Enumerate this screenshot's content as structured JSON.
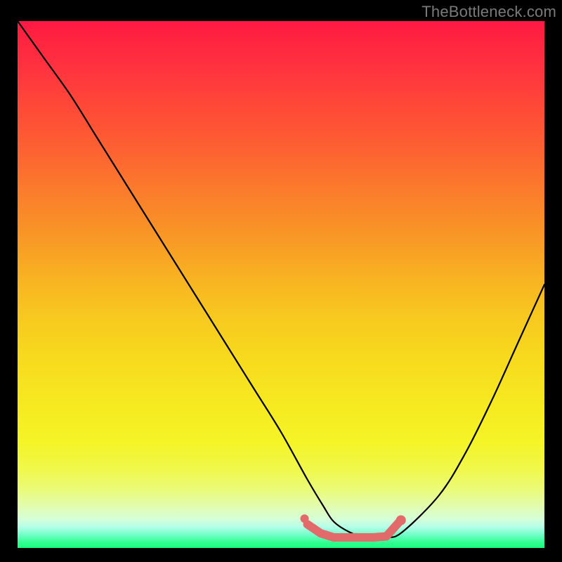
{
  "watermark": "TheBottleneck.com",
  "chart_data": {
    "type": "line",
    "title": "",
    "xlabel": "",
    "ylabel": "",
    "xlim": [
      0,
      100
    ],
    "ylim": [
      0,
      100
    ],
    "grid": false,
    "series": [
      {
        "name": "curve",
        "color": "#000000",
        "x": [
          0,
          5,
          10,
          15,
          20,
          25,
          30,
          35,
          40,
          45,
          50,
          55,
          58,
          60,
          63,
          66,
          70,
          73,
          80,
          85,
          90,
          95,
          100
        ],
        "y": [
          100,
          93,
          86,
          78,
          70,
          62,
          54,
          46,
          38,
          30,
          22,
          13,
          8,
          5,
          3,
          2,
          2,
          3,
          10,
          18,
          28,
          39,
          50
        ]
      },
      {
        "name": "trough-marker",
        "color": "#e26a6a",
        "x": [
          55,
          57.5,
          60,
          62.5,
          65,
          67.5,
          70,
          72.5
        ],
        "y": [
          4.5,
          2.8,
          2.0,
          2.0,
          2.0,
          2.0,
          2.2,
          5.0
        ]
      }
    ]
  },
  "colors": {
    "background": "#000000",
    "curve": "#000000",
    "marker": "#e26a6a",
    "watermark": "#7a7a7a"
  }
}
